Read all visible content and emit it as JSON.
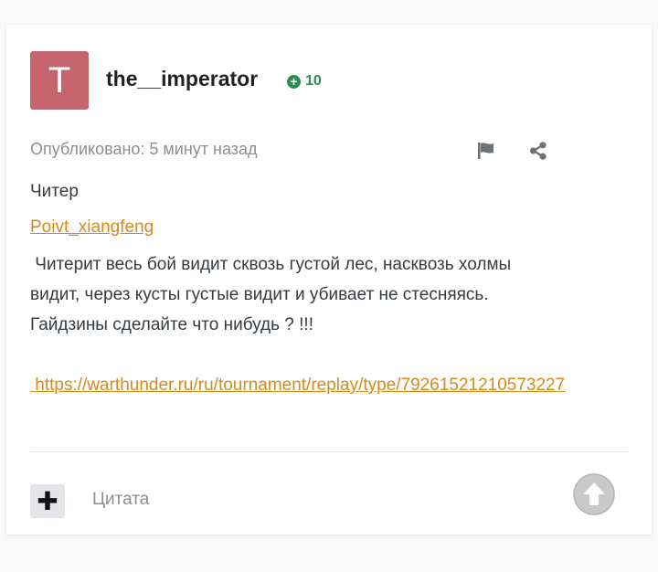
{
  "colors": {
    "avatar_bg": "#c5646e",
    "reputation": "#2f8a56",
    "link": "#d58b17",
    "scroll_top_bg": "#c9c9c9"
  },
  "author": {
    "avatar_letter": "T",
    "username": "the__imperator",
    "reputation_icon": "plus-circle-icon",
    "reputation": "10"
  },
  "meta": {
    "published": "Опубликовано: 5 минут назад",
    "report_icon": "flag-icon",
    "share_icon": "share-icon"
  },
  "content": {
    "line1": "Читер",
    "user_link": "Poivt_xiangfeng",
    "body_line1": "Читерит весь бой видит сквозь густой лес, насквозь холмы",
    "body_line2": "видит, через кусты густые видит и убивает не стесняясь.",
    "body_line3": "Гайдзины сделайте что нибудь ? !!!",
    "replay_link": "https://warthunder.ru/ru/tournament/replay/type/79261521210573227"
  },
  "actions": {
    "add_icon": "plus-icon",
    "add_symbol": "✚",
    "quote_label": "Цитата",
    "scroll_top_icon": "arrow-up-icon"
  }
}
